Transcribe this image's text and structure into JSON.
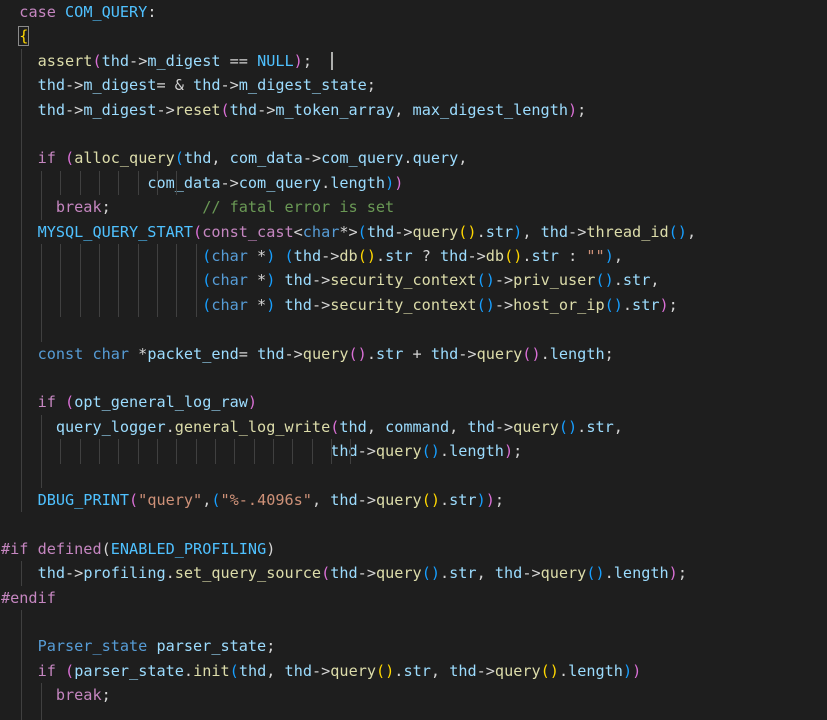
{
  "editor": {
    "language": "C++",
    "colors": {
      "background": "#1e1e1e",
      "keyword": "#c586c0",
      "type": "#569cd6",
      "function": "#dcdcaa",
      "variable": "#9cdcfe",
      "macro": "#4fc1ff",
      "string": "#ce9178",
      "comment": "#6a9955",
      "bracket_level_1": "#ffd700",
      "bracket_level_2": "#da70d6",
      "bracket_level_3": "#179fff"
    },
    "lines": [
      [
        [
          "  ",
          "pun"
        ],
        [
          "case",
          "kw"
        ],
        [
          " ",
          "pun"
        ],
        [
          "COM_QUERY",
          "mac"
        ],
        [
          ":",
          "pun"
        ]
      ],
      [
        [
          "  ",
          "pun"
        ],
        [
          "{",
          "br1 hl"
        ]
      ],
      [
        [
          "    ",
          "pun"
        ],
        [
          "assert",
          "fn"
        ],
        [
          "(",
          "br2"
        ],
        [
          "thd",
          "var"
        ],
        [
          "->",
          "pun"
        ],
        [
          "m_digest",
          "var"
        ],
        [
          " == ",
          "pun"
        ],
        [
          "NULL",
          "mac"
        ],
        [
          ")",
          "br2"
        ],
        [
          ";",
          "pun"
        ]
      ],
      [
        [
          "    ",
          "pun"
        ],
        [
          "thd",
          "var"
        ],
        [
          "->",
          "pun"
        ],
        [
          "m_digest",
          "var"
        ],
        [
          "= & ",
          "pun"
        ],
        [
          "thd",
          "var"
        ],
        [
          "->",
          "pun"
        ],
        [
          "m_digest_state",
          "var"
        ],
        [
          ";",
          "pun"
        ]
      ],
      [
        [
          "    ",
          "pun"
        ],
        [
          "thd",
          "var"
        ],
        [
          "->",
          "pun"
        ],
        [
          "m_digest",
          "var"
        ],
        [
          "->",
          "pun"
        ],
        [
          "reset",
          "fn"
        ],
        [
          "(",
          "br2"
        ],
        [
          "thd",
          "var"
        ],
        [
          "->",
          "pun"
        ],
        [
          "m_token_array",
          "var"
        ],
        [
          ", ",
          "pun"
        ],
        [
          "max_digest_length",
          "var"
        ],
        [
          ")",
          "br2"
        ],
        [
          ";",
          "pun"
        ]
      ],
      [],
      [
        [
          "    ",
          "pun"
        ],
        [
          "if",
          "kw"
        ],
        [
          " ",
          "pun"
        ],
        [
          "(",
          "br2"
        ],
        [
          "alloc_query",
          "fn"
        ],
        [
          "(",
          "br3"
        ],
        [
          "thd",
          "var"
        ],
        [
          ", ",
          "pun"
        ],
        [
          "com_data",
          "var"
        ],
        [
          "->",
          "pun"
        ],
        [
          "com_query",
          "var"
        ],
        [
          ".",
          "pun"
        ],
        [
          "query",
          "var"
        ],
        [
          ",",
          "pun"
        ]
      ],
      [
        [
          "                ",
          "pun"
        ],
        [
          "com_data",
          "var"
        ],
        [
          "->",
          "pun"
        ],
        [
          "com_query",
          "var"
        ],
        [
          ".",
          "pun"
        ],
        [
          "length",
          "var"
        ],
        [
          ")",
          "br3"
        ],
        [
          ")",
          "br2"
        ]
      ],
      [
        [
          "      ",
          "pun"
        ],
        [
          "break",
          "kw"
        ],
        [
          ";",
          "pun"
        ],
        [
          "          ",
          "pun"
        ],
        [
          "// fatal error is set",
          "cmt"
        ]
      ],
      [
        [
          "    ",
          "pun"
        ],
        [
          "MYSQL_QUERY_START",
          "mac"
        ],
        [
          "(",
          "br2"
        ],
        [
          "const_cast",
          "kw"
        ],
        [
          "<",
          "pun"
        ],
        [
          "char",
          "type"
        ],
        [
          "*>",
          "pun"
        ],
        [
          "(",
          "br3"
        ],
        [
          "thd",
          "var"
        ],
        [
          "->",
          "pun"
        ],
        [
          "query",
          "fn"
        ],
        [
          "()",
          "br1"
        ],
        [
          ".",
          "pun"
        ],
        [
          "str",
          "var"
        ],
        [
          ")",
          "br3"
        ],
        [
          ", ",
          "pun"
        ],
        [
          "thd",
          "var"
        ],
        [
          "->",
          "pun"
        ],
        [
          "thread_id",
          "fn"
        ],
        [
          "()",
          "br3"
        ],
        [
          ",",
          "pun"
        ]
      ],
      [
        [
          "                      ",
          "pun"
        ],
        [
          "(",
          "br3"
        ],
        [
          "char",
          "type"
        ],
        [
          " *",
          "pun"
        ],
        [
          ")",
          "br3"
        ],
        [
          " ",
          "pun"
        ],
        [
          "(",
          "br3"
        ],
        [
          "thd",
          "var"
        ],
        [
          "->",
          "pun"
        ],
        [
          "db",
          "fn"
        ],
        [
          "()",
          "br1"
        ],
        [
          ".",
          "pun"
        ],
        [
          "str",
          "var"
        ],
        [
          " ? ",
          "pun"
        ],
        [
          "thd",
          "var"
        ],
        [
          "->",
          "pun"
        ],
        [
          "db",
          "fn"
        ],
        [
          "()",
          "br1"
        ],
        [
          ".",
          "pun"
        ],
        [
          "str",
          "var"
        ],
        [
          " : ",
          "pun"
        ],
        [
          "\"\"",
          "str"
        ],
        [
          ")",
          "br3"
        ],
        [
          ",",
          "pun"
        ]
      ],
      [
        [
          "                      ",
          "pun"
        ],
        [
          "(",
          "br3"
        ],
        [
          "char",
          "type"
        ],
        [
          " *",
          "pun"
        ],
        [
          ")",
          "br3"
        ],
        [
          " ",
          "pun"
        ],
        [
          "thd",
          "var"
        ],
        [
          "->",
          "pun"
        ],
        [
          "security_context",
          "fn"
        ],
        [
          "()",
          "br3"
        ],
        [
          "->",
          "pun"
        ],
        [
          "priv_user",
          "fn"
        ],
        [
          "()",
          "br3"
        ],
        [
          ".",
          "pun"
        ],
        [
          "str",
          "var"
        ],
        [
          ",",
          "pun"
        ]
      ],
      [
        [
          "                      ",
          "pun"
        ],
        [
          "(",
          "br3"
        ],
        [
          "char",
          "type"
        ],
        [
          " *",
          "pun"
        ],
        [
          ")",
          "br3"
        ],
        [
          " ",
          "pun"
        ],
        [
          "thd",
          "var"
        ],
        [
          "->",
          "pun"
        ],
        [
          "security_context",
          "fn"
        ],
        [
          "()",
          "br3"
        ],
        [
          "->",
          "pun"
        ],
        [
          "host_or_ip",
          "fn"
        ],
        [
          "()",
          "br3"
        ],
        [
          ".",
          "pun"
        ],
        [
          "str",
          "var"
        ],
        [
          ")",
          "br2"
        ],
        [
          ";",
          "pun"
        ]
      ],
      [],
      [
        [
          "    ",
          "pun"
        ],
        [
          "const",
          "type"
        ],
        [
          " ",
          "pun"
        ],
        [
          "char",
          "type"
        ],
        [
          " *",
          "pun"
        ],
        [
          "packet_end",
          "var"
        ],
        [
          "= ",
          "pun"
        ],
        [
          "thd",
          "var"
        ],
        [
          "->",
          "pun"
        ],
        [
          "query",
          "fn"
        ],
        [
          "()",
          "br2"
        ],
        [
          ".",
          "pun"
        ],
        [
          "str",
          "var"
        ],
        [
          " + ",
          "pun"
        ],
        [
          "thd",
          "var"
        ],
        [
          "->",
          "pun"
        ],
        [
          "query",
          "fn"
        ],
        [
          "()",
          "br2"
        ],
        [
          ".",
          "pun"
        ],
        [
          "length",
          "var"
        ],
        [
          ";",
          "pun"
        ]
      ],
      [],
      [
        [
          "    ",
          "pun"
        ],
        [
          "if",
          "kw"
        ],
        [
          " ",
          "pun"
        ],
        [
          "(",
          "br2"
        ],
        [
          "opt_general_log_raw",
          "var"
        ],
        [
          ")",
          "br2"
        ]
      ],
      [
        [
          "      ",
          "pun"
        ],
        [
          "query_logger",
          "var"
        ],
        [
          ".",
          "pun"
        ],
        [
          "general_log_write",
          "fn"
        ],
        [
          "(",
          "br2"
        ],
        [
          "thd",
          "var"
        ],
        [
          ", ",
          "pun"
        ],
        [
          "command",
          "var"
        ],
        [
          ", ",
          "pun"
        ],
        [
          "thd",
          "var"
        ],
        [
          "->",
          "pun"
        ],
        [
          "query",
          "fn"
        ],
        [
          "()",
          "br3"
        ],
        [
          ".",
          "pun"
        ],
        [
          "str",
          "var"
        ],
        [
          ",",
          "pun"
        ]
      ],
      [
        [
          "                                    ",
          "pun"
        ],
        [
          "thd",
          "var"
        ],
        [
          "->",
          "pun"
        ],
        [
          "query",
          "fn"
        ],
        [
          "()",
          "br3"
        ],
        [
          ".",
          "pun"
        ],
        [
          "length",
          "var"
        ],
        [
          ")",
          "br2"
        ],
        [
          ";",
          "pun"
        ]
      ],
      [],
      [
        [
          "    ",
          "pun"
        ],
        [
          "DBUG_PRINT",
          "mac"
        ],
        [
          "(",
          "br2"
        ],
        [
          "\"query\"",
          "str"
        ],
        [
          ",",
          "pun"
        ],
        [
          "(",
          "br3"
        ],
        [
          "\"%-.4096s\"",
          "str"
        ],
        [
          ", ",
          "pun"
        ],
        [
          "thd",
          "var"
        ],
        [
          "->",
          "pun"
        ],
        [
          "query",
          "fn"
        ],
        [
          "()",
          "br1"
        ],
        [
          ".",
          "pun"
        ],
        [
          "str",
          "var"
        ],
        [
          ")",
          "br3"
        ],
        [
          ")",
          "br2"
        ],
        [
          ";",
          "pun"
        ]
      ],
      [],
      [
        [
          "#if",
          "kw"
        ],
        [
          " ",
          "pun"
        ],
        [
          "defined",
          "kw"
        ],
        [
          "(",
          "pun"
        ],
        [
          "ENABLED_PROFILING",
          "mac"
        ],
        [
          ")",
          "pun"
        ]
      ],
      [
        [
          "    ",
          "pun"
        ],
        [
          "thd",
          "var"
        ],
        [
          "->",
          "pun"
        ],
        [
          "profiling",
          "var"
        ],
        [
          ".",
          "pun"
        ],
        [
          "set_query_source",
          "fn"
        ],
        [
          "(",
          "br2"
        ],
        [
          "thd",
          "var"
        ],
        [
          "->",
          "pun"
        ],
        [
          "query",
          "fn"
        ],
        [
          "()",
          "br3"
        ],
        [
          ".",
          "pun"
        ],
        [
          "str",
          "var"
        ],
        [
          ", ",
          "pun"
        ],
        [
          "thd",
          "var"
        ],
        [
          "->",
          "pun"
        ],
        [
          "query",
          "fn"
        ],
        [
          "()",
          "br3"
        ],
        [
          ".",
          "pun"
        ],
        [
          "length",
          "var"
        ],
        [
          ")",
          "br2"
        ],
        [
          ";",
          "pun"
        ]
      ],
      [
        [
          "#endif",
          "kw"
        ]
      ],
      [],
      [
        [
          "    ",
          "pun"
        ],
        [
          "Parser_state",
          "type"
        ],
        [
          " ",
          "pun"
        ],
        [
          "parser_state",
          "var"
        ],
        [
          ";",
          "pun"
        ]
      ],
      [
        [
          "    ",
          "pun"
        ],
        [
          "if",
          "kw"
        ],
        [
          " ",
          "pun"
        ],
        [
          "(",
          "br2"
        ],
        [
          "parser_state",
          "var"
        ],
        [
          ".",
          "pun"
        ],
        [
          "init",
          "fn"
        ],
        [
          "(",
          "br3"
        ],
        [
          "thd",
          "var"
        ],
        [
          ", ",
          "pun"
        ],
        [
          "thd",
          "var"
        ],
        [
          "->",
          "pun"
        ],
        [
          "query",
          "fn"
        ],
        [
          "()",
          "br1"
        ],
        [
          ".",
          "pun"
        ],
        [
          "str",
          "var"
        ],
        [
          ", ",
          "pun"
        ],
        [
          "thd",
          "var"
        ],
        [
          "->",
          "pun"
        ],
        [
          "query",
          "fn"
        ],
        [
          "()",
          "br1"
        ],
        [
          ".",
          "pun"
        ],
        [
          "length",
          "var"
        ],
        [
          ")",
          "br3"
        ],
        [
          ")",
          "br2"
        ]
      ],
      [
        [
          "      ",
          "pun"
        ],
        [
          "break",
          "kw"
        ],
        [
          ";",
          "pun"
        ]
      ],
      []
    ]
  }
}
